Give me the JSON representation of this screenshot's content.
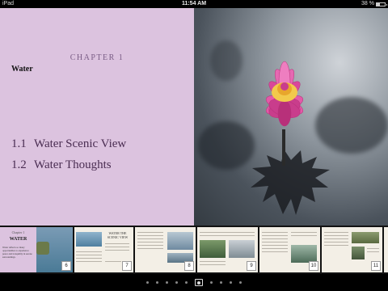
{
  "status_bar": {
    "device": "iPad",
    "time": "11:54 AM",
    "battery": "38 %",
    "battery_level": 0.38
  },
  "chapter": {
    "label": "CHAPTER 1",
    "title": "Water",
    "sections": [
      {
        "num": "1.1",
        "title": "Water Scenic View"
      },
      {
        "num": "1.2",
        "title": "Water Thoughts"
      }
    ]
  },
  "thumbnails": {
    "first": {
      "label": "Chapter 1",
      "title": "WATER",
      "text": "Water reflects so many opportunities to experience peace and tranquility in serene surroundings."
    },
    "second": {
      "title": "WATER THE SCENIC VIEW"
    },
    "page_numbers": [
      "6",
      "7",
      "8",
      "9",
      "10",
      "11"
    ]
  },
  "page_dots": {
    "count": 10,
    "active_index": 5
  },
  "colors": {
    "page_background": "#dcc3df",
    "accent": "#7a5d86",
    "lotus": "#d9479a",
    "lotus_center": "#f2c94c"
  }
}
